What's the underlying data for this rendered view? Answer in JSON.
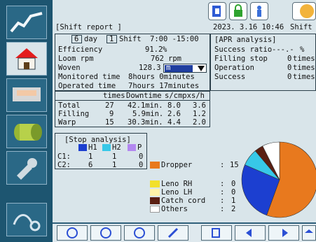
{
  "header": {
    "title": "[Shift report ]",
    "datetime": "2023. 3.16 10:46",
    "shift_label": "Shift"
  },
  "report": {
    "day_checkbox": "6",
    "day_label": "day",
    "shift_checkbox": "1",
    "shift_label": "Shift",
    "time_range": "7:00 -15:00",
    "efficiency_label": "Efficiency",
    "efficiency_value": "91.2",
    "efficiency_unit": "%",
    "loom_rpm_label": "Loom rpm",
    "loom_rpm_value": "762",
    "loom_rpm_unit": "rpm",
    "woven_label": "Woven",
    "woven_value": "128.3",
    "woven_unit": "m",
    "monitored_label": "Monitored time",
    "monitored_value": "8hours  0minutes",
    "operated_label": "Operated time",
    "operated_value": "7hours 17minutes"
  },
  "stops_table": {
    "headers": [
      "times",
      "Downtime",
      "s/cmpx",
      "s/h"
    ],
    "rows": [
      {
        "label": "Total",
        "times": "27",
        "downtime": "42.1min.",
        "scmpx": "8.0",
        "sh": "3.6"
      },
      {
        "label": "Filling",
        "times": "9",
        "downtime": "5.9min.",
        "scmpx": "2.6",
        "sh": "1.2"
      },
      {
        "label": "Warp",
        "times": "15",
        "downtime": "30.3min.",
        "scmpx": "4.4",
        "sh": "2.0"
      }
    ]
  },
  "apr": {
    "title": "[APR analysis]",
    "rows": [
      {
        "label": "Success ratio",
        "value": "---.-",
        "unit": "%"
      },
      {
        "label": "Filling stop",
        "value": "0",
        "unit": "times"
      },
      {
        "label": "Operation",
        "value": "0",
        "unit": "times"
      },
      {
        "label": "Success",
        "value": "0",
        "unit": "times"
      }
    ]
  },
  "stop_analysis": {
    "title": "[Stop analysis]",
    "legend": [
      {
        "label": "H1",
        "color": "#1c3fd0"
      },
      {
        "label": "H2",
        "color": "#37c8e8"
      },
      {
        "label": "P",
        "color": "#b388f0"
      }
    ],
    "rows": [
      {
        "label": "C1:",
        "h1": "1",
        "h2": "1",
        "p": "0"
      },
      {
        "label": "C2:",
        "h1": "6",
        "h2": "1",
        "p": "0"
      }
    ],
    "causes": [
      {
        "label": "Dropper",
        "value": "15",
        "color": "#e8791e"
      },
      {
        "label": "Leno RH",
        "value": "0",
        "color": "#f2e02a"
      },
      {
        "label": "Leno LH",
        "value": "0",
        "color": "#fff3a8"
      },
      {
        "label": "Catch cord",
        "value": "1",
        "color": "#5a1f12"
      },
      {
        "label": "Others",
        "value": "2",
        "color": "#ffffff"
      }
    ]
  },
  "icons": {
    "top": [
      "door-exit-icon",
      "lock-icon",
      "operator-icon",
      "start-icon"
    ],
    "sidebar": [
      "home-icon",
      "loom-icon",
      "fabric-roll-icon",
      "tool-icon",
      "yarn-icon"
    ],
    "bottom": [
      "rotate-left-icon",
      "speed-icon",
      "badge-24-icon",
      "pen-icon",
      "copy-icon",
      "prev-icon",
      "next-icon",
      "home-icon"
    ]
  },
  "chart_data": {
    "type": "pie",
    "series": [
      {
        "values": [
          15,
          7,
          2,
          1,
          2
        ]
      }
    ],
    "categories": [
      "Dropper",
      "Blue segment",
      "Light blue segment",
      "Catch cord",
      "Others"
    ]
  }
}
